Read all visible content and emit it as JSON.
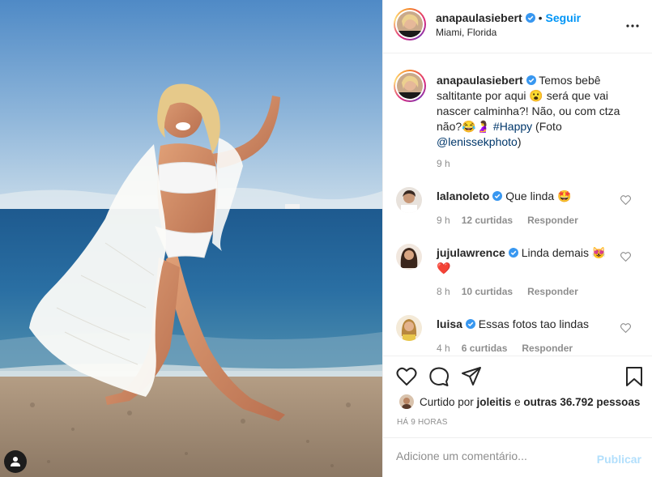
{
  "post": {
    "username": "anapaulasiebert",
    "follow_label": "Seguir",
    "separator": "•",
    "location": "Miami, Florida",
    "more_icon": "more-horizontal-icon"
  },
  "caption": {
    "username": "anapaulasiebert",
    "text": "Temos bebê saltitante por aqui 😮 será que vai nascer calminha?! Não, ou com ctza não?😂🤰",
    "hashtag": "#Happy",
    "text_after": " (Foto ",
    "mention": "@lenissekphoto",
    "close": ")",
    "time": "9 h"
  },
  "comments": [
    {
      "username": "lalanoleto",
      "text": "Que linda 🤩",
      "time": "9 h",
      "likes": "12 curtidas",
      "reply": "Responder",
      "avatar_color": "#d8d2cc"
    },
    {
      "username": "jujulawrence",
      "text": "Linda demais 😻 ❤️",
      "time": "8 h",
      "likes": "10 curtidas",
      "reply": "Responder",
      "avatar_color": "#6b4a3a"
    },
    {
      "username": "luisa",
      "text": "Essas fotos tao lindas",
      "time": "4 h",
      "likes": "6 curtidas",
      "reply": "Responder",
      "avatar_color": "#c9a24a"
    }
  ],
  "actions": {
    "like_icon": "heart-icon",
    "comment_icon": "comment-icon",
    "share_icon": "share-icon",
    "save_icon": "bookmark-icon"
  },
  "likes": {
    "prefix": "Curtido por ",
    "first_user": "joleitis",
    "middle": " e ",
    "others": "outras 36.792 pessoas"
  },
  "post_time": "HÁ 9 HORAS",
  "add_comment": {
    "placeholder": "Adicione um comentário...",
    "publish_label": "Publicar"
  },
  "colors": {
    "accent": "#0095f6",
    "verified": "#3897f0",
    "muted": "#8e8e8e",
    "publish_disabled": "#b2dffc"
  }
}
